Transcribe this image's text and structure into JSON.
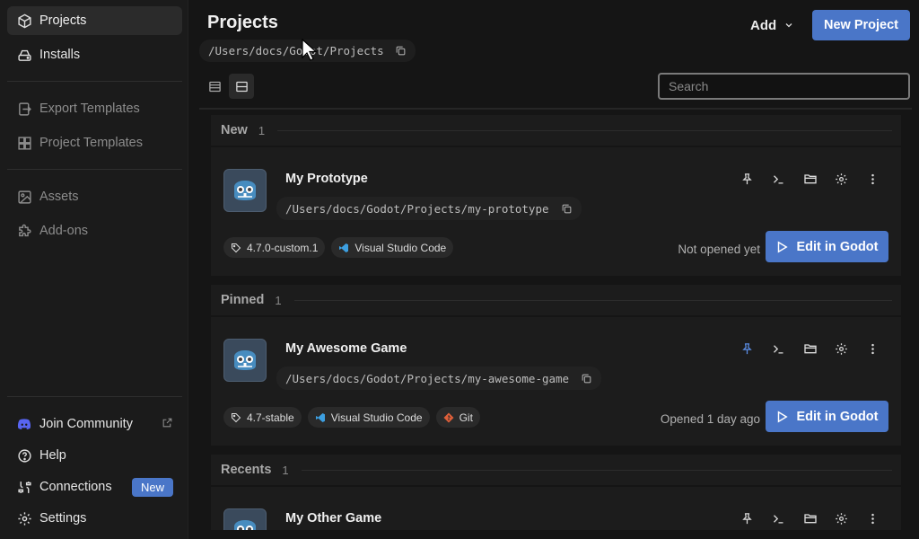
{
  "sidebar": {
    "items": [
      {
        "label": "Projects",
        "icon": "cube-icon"
      },
      {
        "label": "Installs",
        "icon": "drive-icon"
      },
      {
        "label": "Export Templates",
        "icon": "export-icon"
      },
      {
        "label": "Project Templates",
        "icon": "templates-icon"
      },
      {
        "label": "Assets",
        "icon": "image-icon"
      },
      {
        "label": "Add-ons",
        "icon": "puzzle-icon"
      }
    ],
    "footer": [
      {
        "label": "Join Community",
        "icon": "discord-icon"
      },
      {
        "label": "Help",
        "icon": "help-icon"
      },
      {
        "label": "Connections",
        "icon": "connections-icon",
        "badge": "New"
      },
      {
        "label": "Settings",
        "icon": "gear-icon"
      }
    ]
  },
  "header": {
    "title": "Projects",
    "path": "/Users/docs/Godot/Projects",
    "add_label": "Add",
    "new_project_label": "New Project",
    "search_placeholder": "Search"
  },
  "sections": [
    {
      "name": "New",
      "count": "1"
    },
    {
      "name": "Pinned",
      "count": "1"
    },
    {
      "name": "Recents",
      "count": "1"
    }
  ],
  "projects": [
    {
      "name": "My Prototype",
      "path": "/Users/docs/Godot/Projects/my-prototype",
      "tags": [
        "4.7.0-custom.1",
        "Visual Studio Code"
      ],
      "status": "Not opened yet",
      "pinned": false,
      "edit_label": "Edit in Godot"
    },
    {
      "name": "My Awesome Game",
      "path": "/Users/docs/Godot/Projects/my-awesome-game",
      "tags": [
        "4.7-stable",
        "Visual Studio Code",
        "Git"
      ],
      "status": "Opened 1 day ago",
      "pinned": true,
      "edit_label": "Edit in Godot"
    },
    {
      "name": "My Other Game",
      "pinned": false
    }
  ],
  "colors": {
    "accent": "#4a76c8",
    "pinned": "#5b8ee6",
    "vscode": "#3d9fe0",
    "git": "#e0603a"
  }
}
